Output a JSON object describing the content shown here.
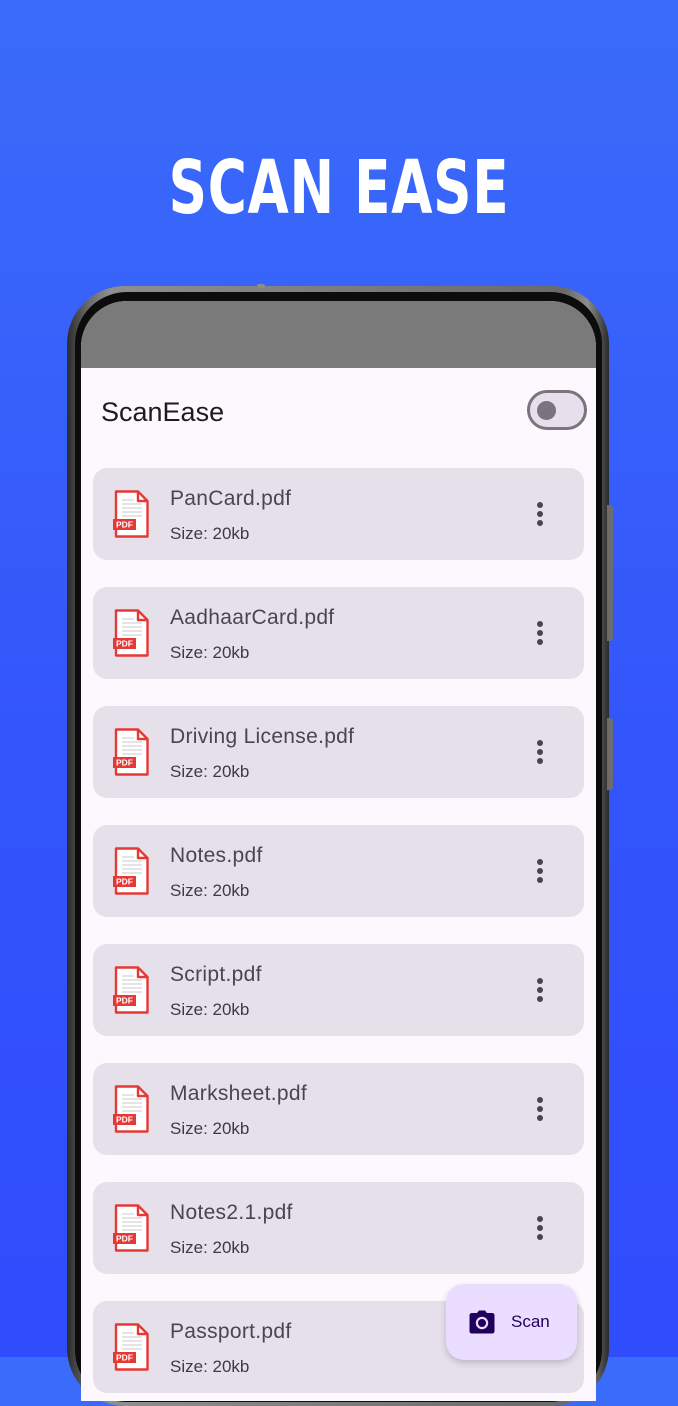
{
  "promo": {
    "title": "SCAN EASE"
  },
  "app": {
    "title": "ScanEase",
    "theme_toggle_on": false
  },
  "files": [
    {
      "name": "PanCard.pdf",
      "size": "Size: 20kb",
      "icon": "pdf-file-icon"
    },
    {
      "name": "AadhaarCard.pdf",
      "size": "Size: 20kb",
      "icon": "pdf-file-icon"
    },
    {
      "name": "Driving License.pdf",
      "size": "Size: 20kb",
      "icon": "pdf-file-icon"
    },
    {
      "name": "Notes.pdf",
      "size": "Size: 20kb",
      "icon": "pdf-file-icon"
    },
    {
      "name": "Script.pdf",
      "size": "Size: 20kb",
      "icon": "pdf-file-icon"
    },
    {
      "name": "Marksheet.pdf",
      "size": "Size: 20kb",
      "icon": "pdf-file-icon"
    },
    {
      "name": "Notes2.1.pdf",
      "size": "Size: 20kb",
      "icon": "pdf-file-icon"
    },
    {
      "name": "Passport.pdf",
      "size": "Size: 20kb",
      "icon": "pdf-file-icon"
    }
  ],
  "fab": {
    "label": "Scan",
    "icon": "camera-icon"
  },
  "pdf_badge": "PDF",
  "colors": {
    "background_top": "#3b6cf9",
    "background_bottom": "#2f4cfd",
    "card": "#e6e0ea",
    "pdf_red": "#e53935",
    "fab": "#eaddff"
  }
}
